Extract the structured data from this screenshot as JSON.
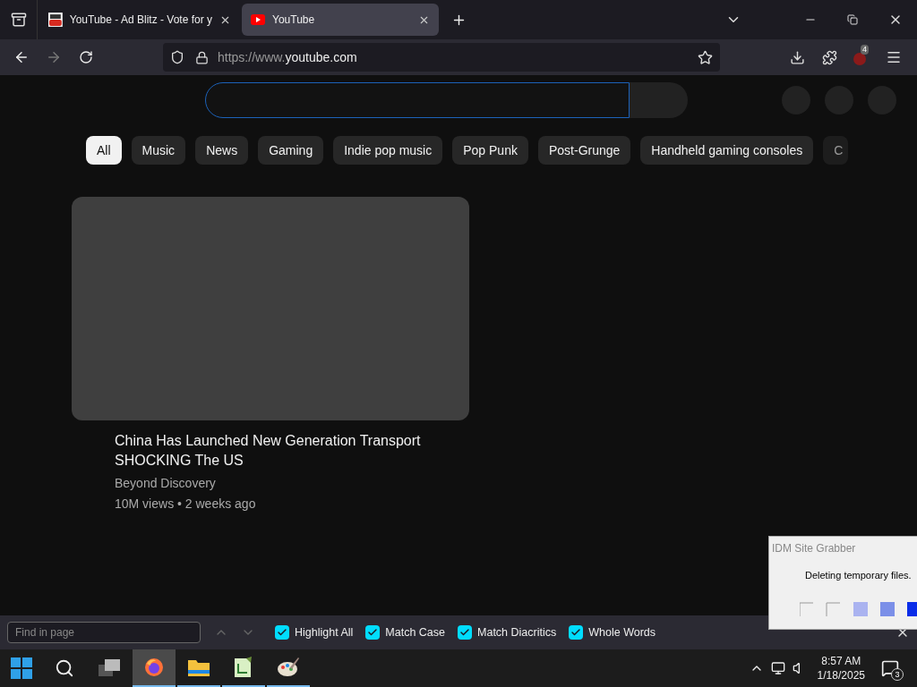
{
  "tabs": [
    {
      "title": "YouTube - Ad Blitz - Vote for y",
      "selected": false,
      "kind": "youtube-old"
    },
    {
      "title": "YouTube",
      "selected": true,
      "kind": "youtube"
    }
  ],
  "address_bar": {
    "prefix": "https://www.",
    "domain": "youtube.com"
  },
  "extension_badge": "4",
  "chips": [
    {
      "label": "All",
      "selected": true
    },
    {
      "label": "Music",
      "selected": false
    },
    {
      "label": "News",
      "selected": false
    },
    {
      "label": "Gaming",
      "selected": false
    },
    {
      "label": "Indie pop music",
      "selected": false
    },
    {
      "label": "Pop Punk",
      "selected": false
    },
    {
      "label": "Post-Grunge",
      "selected": false
    },
    {
      "label": "Handheld gaming consoles",
      "selected": false
    },
    {
      "label": "C",
      "selected": false
    }
  ],
  "video": {
    "title": "China Has Launched New Generation Transport SHOCKING The US",
    "channel": "Beyond Discovery",
    "meta": "10M views • 2 weeks ago"
  },
  "find_bar": {
    "placeholder": "Find in page",
    "options": [
      {
        "label": "Highlight All",
        "checked": true
      },
      {
        "label": "Match Case",
        "checked": true
      },
      {
        "label": "Match Diacritics",
        "checked": true
      },
      {
        "label": "Whole Words",
        "checked": true
      }
    ]
  },
  "idm_dialog": {
    "title": "IDM Site Grabber",
    "message": "Deleting temporary files."
  },
  "taskbar": {
    "apps": [
      {
        "kind": "firefox",
        "active": true
      },
      {
        "kind": "folder",
        "active": false
      },
      {
        "kind": "notepad",
        "active": false
      },
      {
        "kind": "paint",
        "active": false
      }
    ],
    "time": "8:57 AM",
    "date": "1/18/2025",
    "notifications": "3"
  }
}
